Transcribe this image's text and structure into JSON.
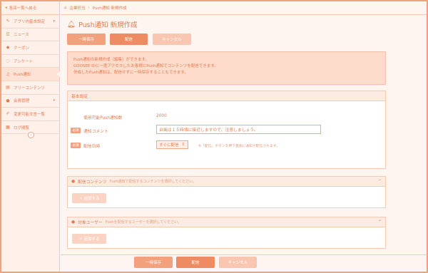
{
  "sidebar": {
    "back_label": "各店一覧へ戻る",
    "items": [
      {
        "label": "アプリ内基本設定",
        "icon": "wrench-icon"
      },
      {
        "label": "ニュース",
        "icon": "list-icon"
      },
      {
        "label": "クーポン",
        "icon": "tag-icon"
      },
      {
        "label": "アンケート",
        "icon": "chat-icon"
      },
      {
        "label": "Push通知",
        "icon": "bell-icon"
      },
      {
        "label": "フリーコンテンツ",
        "icon": "document-icon"
      },
      {
        "label": "会員管理",
        "icon": "user-icon"
      },
      {
        "label": "変更可能文言一覧",
        "icon": "edit-icon"
      },
      {
        "label": "ログ閲覧",
        "icon": "log-icon"
      }
    ]
  },
  "breadcrumb": {
    "parent": "企業担当",
    "current": "Push通知 新規作成"
  },
  "page": {
    "title": "Push通知 新規作成"
  },
  "buttons": {
    "save": "一時保存",
    "send": "配信",
    "cancel": "キャンセル"
  },
  "info": {
    "line1": "Push通知の新規作成（編集）ができます。",
    "line2": "GOOSEE IDに一度アクセスしたお客様にPush通知でコンテンツを配信できます。",
    "line3": "作成したPush通知は、配信せずに一時保存することもできます。"
  },
  "basic": {
    "title": "基本設定",
    "available_label": "使用可能Push通知数",
    "available_value": "2000",
    "required_badge": "必須",
    "comment_label": "通知コメント",
    "comment_value": "台風は１５時頃に接近しますので、注意しましょう。",
    "datetime_label": "配信日時",
    "datetime_option": "すぐに配信",
    "datetime_note": "※「配信」ボタンを押下直後に通知が配信されます。"
  },
  "content_panel": {
    "title": "配信コンテンツ",
    "subtitle": "Push通知で配信するコンテンツを選択してください。",
    "add_label": "＋ 追加する"
  },
  "target_panel": {
    "title": "対象ユーザー",
    "subtitle": "Pushを配信するユーザーを選択してください。",
    "add_label": "＋ 追加する"
  },
  "colors": {
    "accent": "#ee8b62",
    "background": "#fff5f0"
  }
}
